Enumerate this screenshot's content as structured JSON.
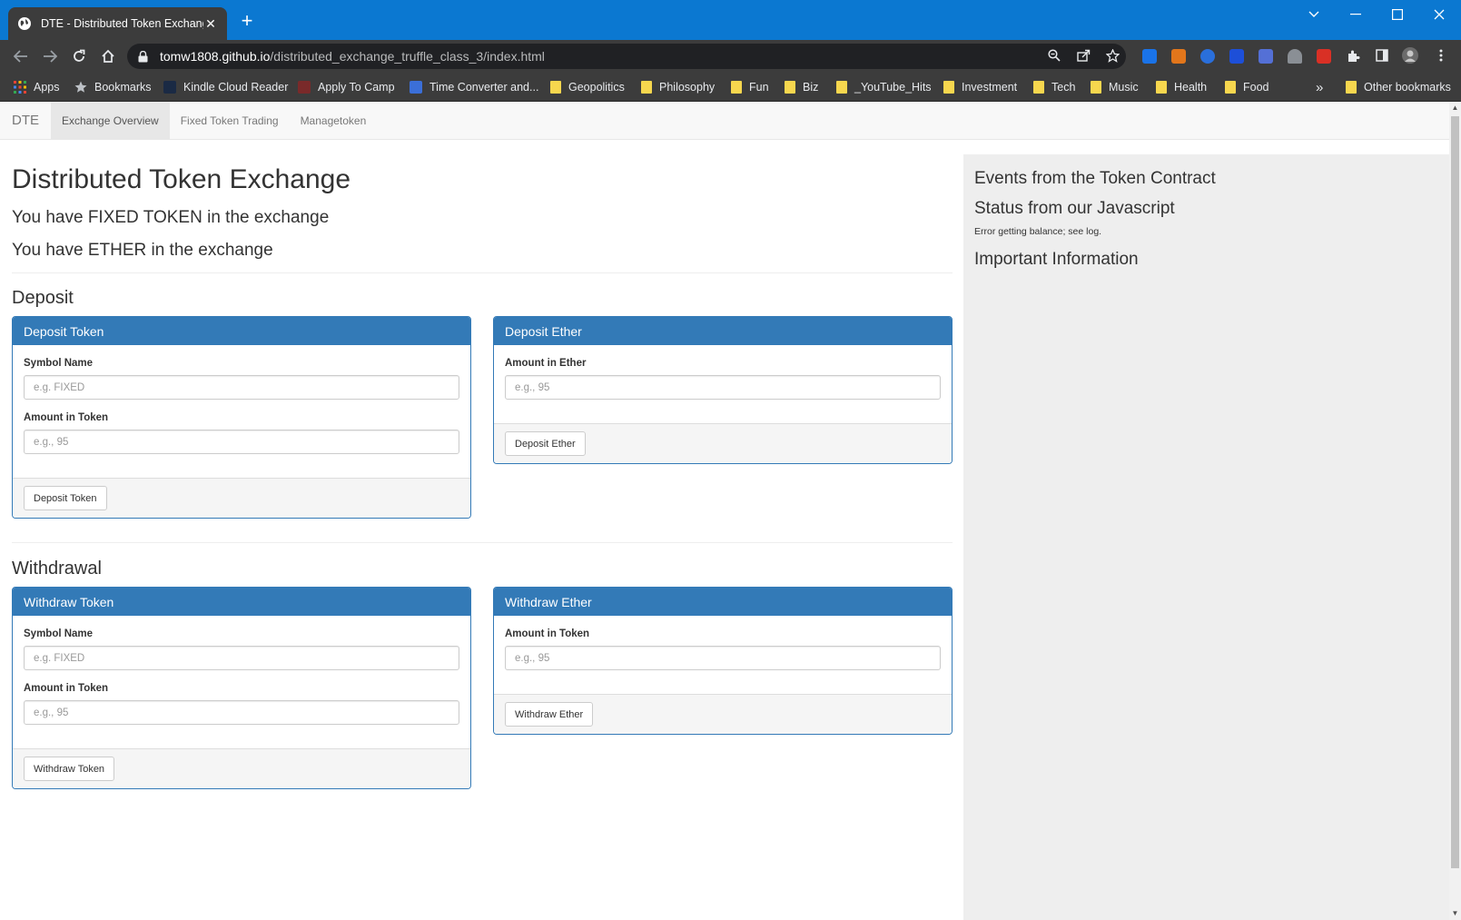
{
  "browser": {
    "tab_title": "DTE - Distributed Token Exchange",
    "url_host": "tomw1808.github.io",
    "url_path": "/distributed_exchange_truffle_class_3/index.html",
    "bookmarks": [
      {
        "label": "Apps",
        "icon": "apps-grid-icon"
      },
      {
        "label": "Bookmarks",
        "icon": "star-icon"
      },
      {
        "label": "Kindle Cloud Reader",
        "icon": "kindle-icon"
      },
      {
        "label": "Apply To Camp",
        "icon": "camp-icon"
      },
      {
        "label": "Time Converter and...",
        "icon": "time-icon"
      },
      {
        "label": "Geopolitics",
        "icon": "folder-icon"
      },
      {
        "label": "Philosophy",
        "icon": "folder-icon"
      },
      {
        "label": "Fun",
        "icon": "folder-icon"
      },
      {
        "label": "Biz",
        "icon": "folder-icon"
      },
      {
        "label": "_YouTube_Hits",
        "icon": "folder-icon"
      },
      {
        "label": "Investment",
        "icon": "folder-icon"
      },
      {
        "label": "Tech",
        "icon": "folder-icon"
      },
      {
        "label": "Music",
        "icon": "folder-icon"
      },
      {
        "label": "Health",
        "icon": "folder-icon"
      },
      {
        "label": "Food",
        "icon": "folder-icon"
      }
    ],
    "bookmarks_overflow": "»",
    "other_bookmarks": "Other bookmarks"
  },
  "nav": {
    "brand": "DTE",
    "links": [
      "Exchange Overview",
      "Fixed Token Trading",
      "Managetoken"
    ]
  },
  "main": {
    "title": "Distributed Token Exchange",
    "balance_token": "You have FIXED TOKEN in the exchange",
    "balance_ether": "You have ETHER in the exchange",
    "deposit_section": "Deposit",
    "withdrawal_section": "Withdrawal",
    "deposit_token": {
      "heading": "Deposit Token",
      "symbol_label": "Symbol Name",
      "symbol_placeholder": "e.g. FIXED",
      "amount_label": "Amount in Token",
      "amount_placeholder": "e.g., 95",
      "button": "Deposit Token"
    },
    "deposit_ether": {
      "heading": "Deposit Ether",
      "amount_label": "Amount in Ether",
      "amount_placeholder": "e.g., 95",
      "button": "Deposit Ether"
    },
    "withdraw_token": {
      "heading": "Withdraw Token",
      "symbol_label": "Symbol Name",
      "symbol_placeholder": "e.g. FIXED",
      "amount_label": "Amount in Token",
      "amount_placeholder": "e.g., 95",
      "button": "Withdraw Token"
    },
    "withdraw_ether": {
      "heading": "Withdraw Ether",
      "amount_label": "Amount in Token",
      "amount_placeholder": "e.g., 95",
      "button": "Withdraw Ether"
    }
  },
  "sidebar": {
    "events_title": "Events from the Token Contract",
    "status_title": "Status from our Javascript",
    "status_message": "Error getting balance; see log.",
    "info_title": "Important Information"
  },
  "colors": {
    "panel_primary": "#337ab7",
    "browser_titlebar": "#0b78d1",
    "browser_toolbar": "#3c3c3c"
  }
}
